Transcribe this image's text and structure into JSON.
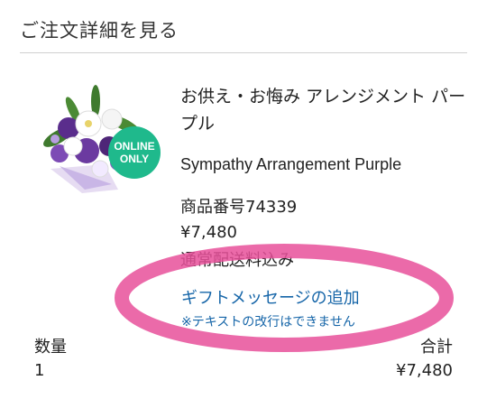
{
  "header": {
    "title": "ご注文詳細を見る"
  },
  "product": {
    "name_ja": "お供え・お悔み アレンジメント パープル",
    "name_en": "Sympathy Arrangement Purple",
    "sku": "商品番号74339",
    "price": "¥7,480",
    "shipping": "通常配送料込み",
    "badge_line1": "ONLINE",
    "badge_line2": "ONLY"
  },
  "gift": {
    "link_label": "ギフトメッセージの追加",
    "note": "※テキストの改行はできません"
  },
  "summary": {
    "qty_label": "数量",
    "qty_value": "1",
    "total_label": "合計",
    "total_value": "¥7,480"
  },
  "colors": {
    "link": "#1565a8",
    "badge": "#1fb98c",
    "highlight": "#e8509a"
  }
}
